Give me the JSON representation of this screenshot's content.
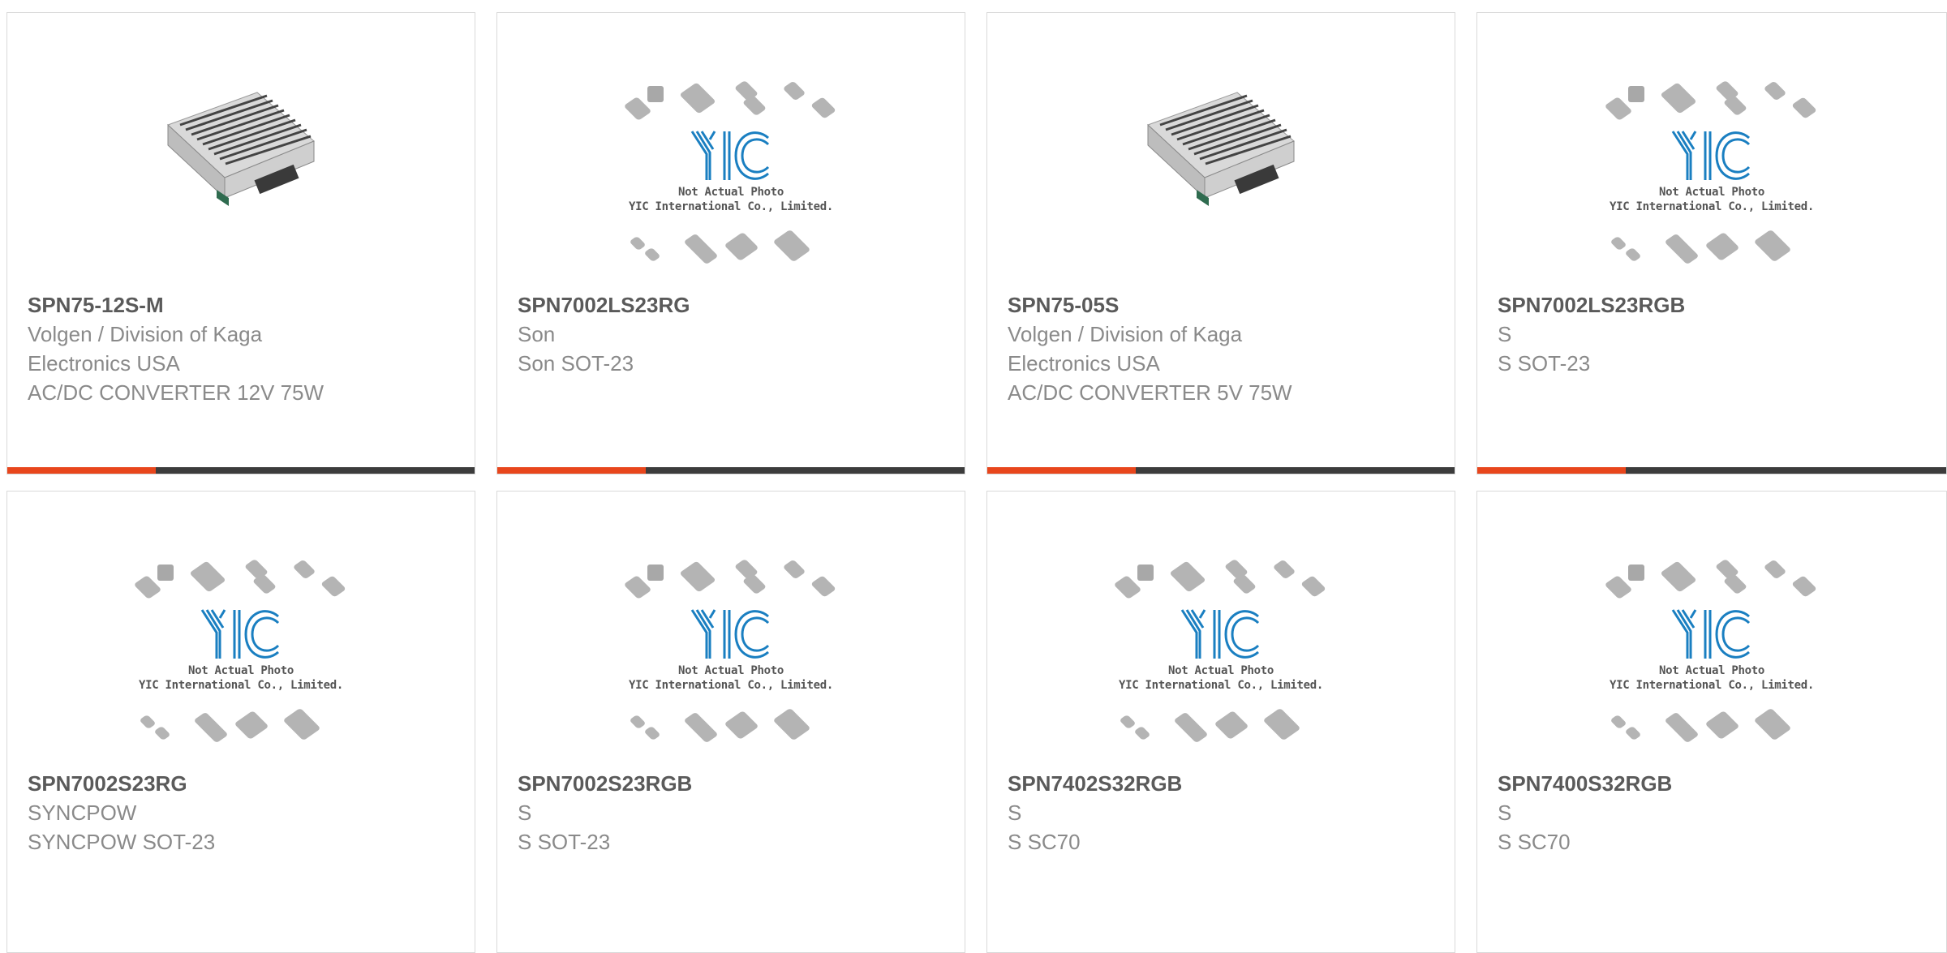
{
  "products": [
    {
      "part_number": "SPN75-12S-M",
      "manufacturer": "Volgen / Division of Kaga",
      "manufacturer_line2": "Electronics USA",
      "description": "AC/DC CONVERTER 12V 75W",
      "image": "power-supply-photo"
    },
    {
      "part_number": "SPN7002LS23RG",
      "manufacturer": "Son",
      "manufacturer_line2": "",
      "description": "Son SOT-23",
      "image": "placeholder-photo"
    },
    {
      "part_number": "SPN75-05S",
      "manufacturer": "Volgen / Division of Kaga",
      "manufacturer_line2": "Electronics USA",
      "description": "AC/DC CONVERTER 5V 75W",
      "image": "power-supply-photo"
    },
    {
      "part_number": "SPN7002LS23RGB",
      "manufacturer": "S",
      "manufacturer_line2": "",
      "description": "S SOT-23",
      "image": "placeholder-photo"
    },
    {
      "part_number": "SPN7002S23RG",
      "manufacturer": "SYNCPOW",
      "manufacturer_line2": "",
      "description": "SYNCPOW SOT-23",
      "image": "placeholder-photo"
    },
    {
      "part_number": "SPN7002S23RGB",
      "manufacturer": "S",
      "manufacturer_line2": "",
      "description": "S SOT-23",
      "image": "placeholder-photo"
    },
    {
      "part_number": "SPN7402S32RGB",
      "manufacturer": "S",
      "manufacturer_line2": "",
      "description": "S SC70",
      "image": "placeholder-photo"
    },
    {
      "part_number": "SPN7400S32RGB",
      "manufacturer": "S",
      "manufacturer_line2": "",
      "description": "S SC70",
      "image": "placeholder-photo"
    }
  ],
  "placeholder": {
    "logo_text": "YIC",
    "caption_line1": "Not Actual Photo",
    "caption_line2": "YIC International Co., Limited."
  },
  "colors": {
    "accent": "#e8461c",
    "bar": "#3c3c3c",
    "logo_blue": "#1a7fc1"
  }
}
